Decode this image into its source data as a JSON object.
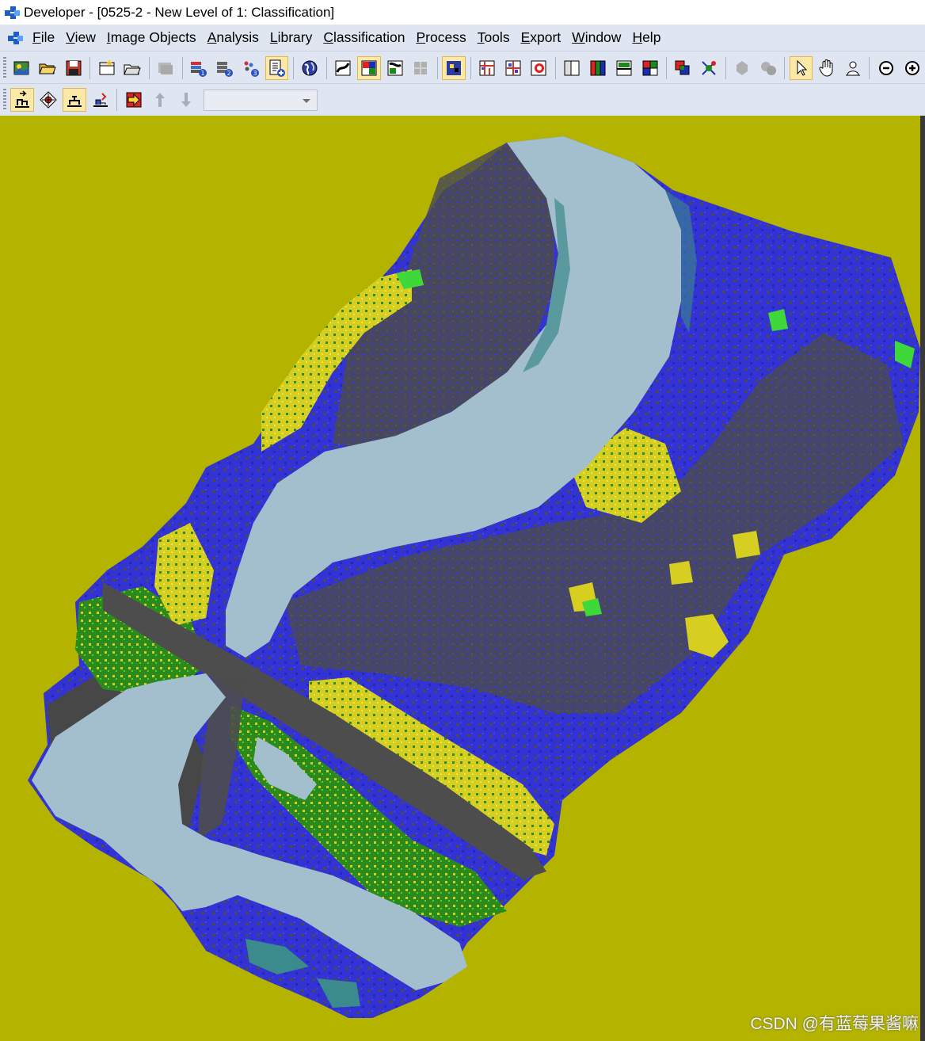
{
  "window": {
    "title": "Developer - [0525-2 - New Level of 1: Classification]"
  },
  "menu": {
    "items": [
      {
        "key": "F",
        "rest": "ile"
      },
      {
        "key": "V",
        "rest": "iew"
      },
      {
        "key": "I",
        "rest": "mage Objects"
      },
      {
        "key": "A",
        "rest": "nalysis"
      },
      {
        "key": "L",
        "rest": "ibrary"
      },
      {
        "key": "C",
        "rest": "lassification"
      },
      {
        "key": "P",
        "rest": "rocess"
      },
      {
        "key": "T",
        "rest": "ools"
      },
      {
        "key": "E",
        "rest": "xport"
      },
      {
        "key": "W",
        "rest": "indow"
      },
      {
        "key": "H",
        "rest": "elp"
      }
    ]
  },
  "toolbar": {
    "level_combo_value": ""
  },
  "classification_colors": {
    "background": "#b3b300",
    "water": "#a3bfce",
    "shallow_water": "#3b8a8c",
    "bare_soil": "#4a4a4a",
    "vegetation_blue": "#3232d0",
    "vegetation_green": "#2c8a1c",
    "vegetation_yellow": "#d8d020",
    "bright_green": "#3ed83a"
  },
  "watermark": {
    "text": "CSDN @有蓝莓果酱嘛"
  }
}
